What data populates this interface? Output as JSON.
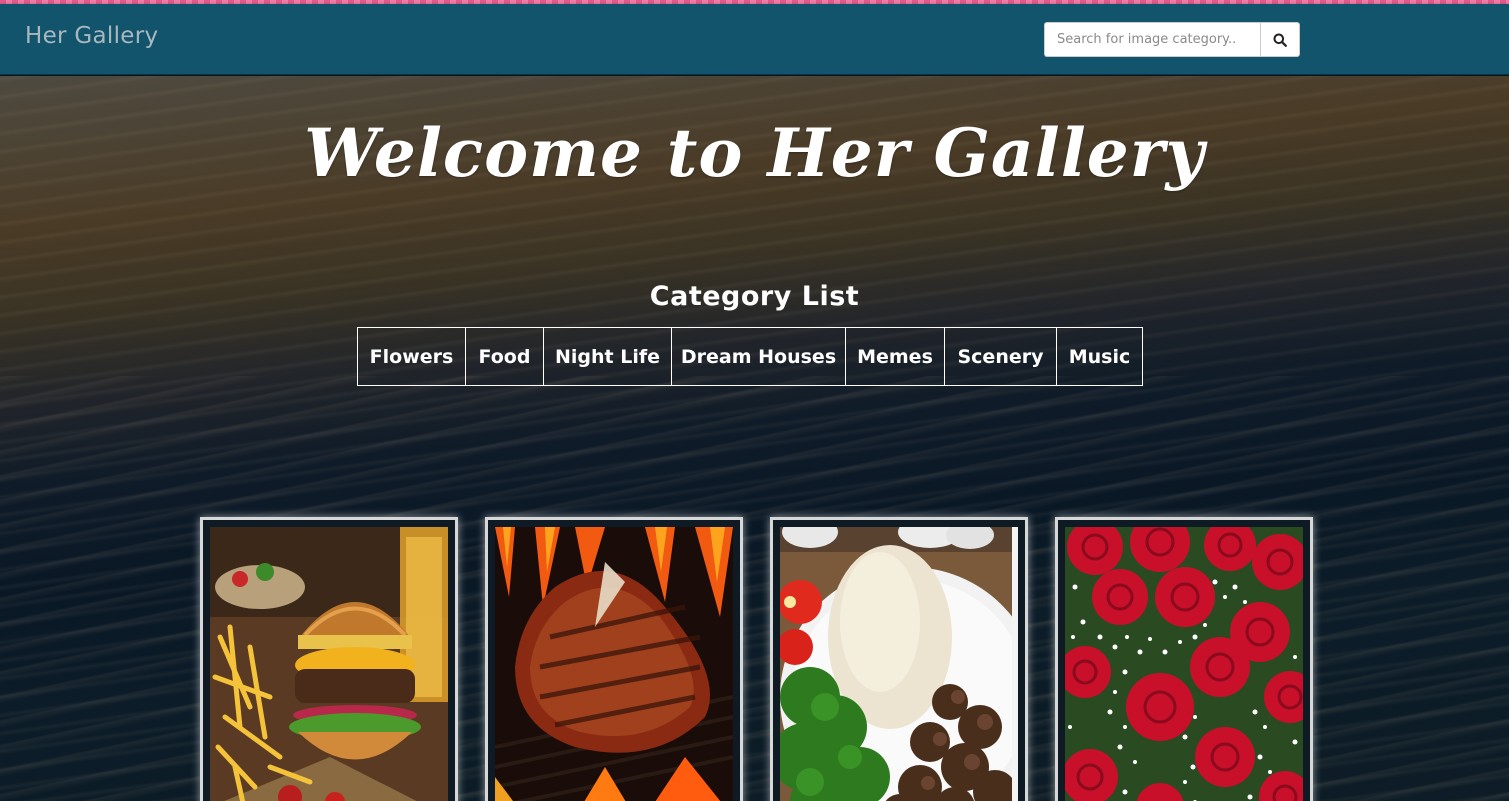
{
  "app": {
    "brand": "Her Gallery"
  },
  "search": {
    "placeholder": "Search for image category.."
  },
  "hero": {
    "welcome": "Welcome to Her Gallery",
    "category_title": "Category List"
  },
  "categories": [
    {
      "label": "Flowers"
    },
    {
      "label": "Food"
    },
    {
      "label": "Night Life"
    },
    {
      "label": "Dream Houses"
    },
    {
      "label": "Memes"
    },
    {
      "label": "Scenery"
    },
    {
      "label": "Music"
    }
  ],
  "gallery": [
    {
      "subject": "burger-and-fries-photo"
    },
    {
      "subject": "grilled-steak-photo"
    },
    {
      "subject": "fufu-and-vegetables-photo"
    },
    {
      "subject": "red-roses-photo"
    }
  ],
  "colors": {
    "navbar": "#12546c",
    "brand_text": "#a8b8be",
    "accent_stripe": "#e05a8c"
  }
}
